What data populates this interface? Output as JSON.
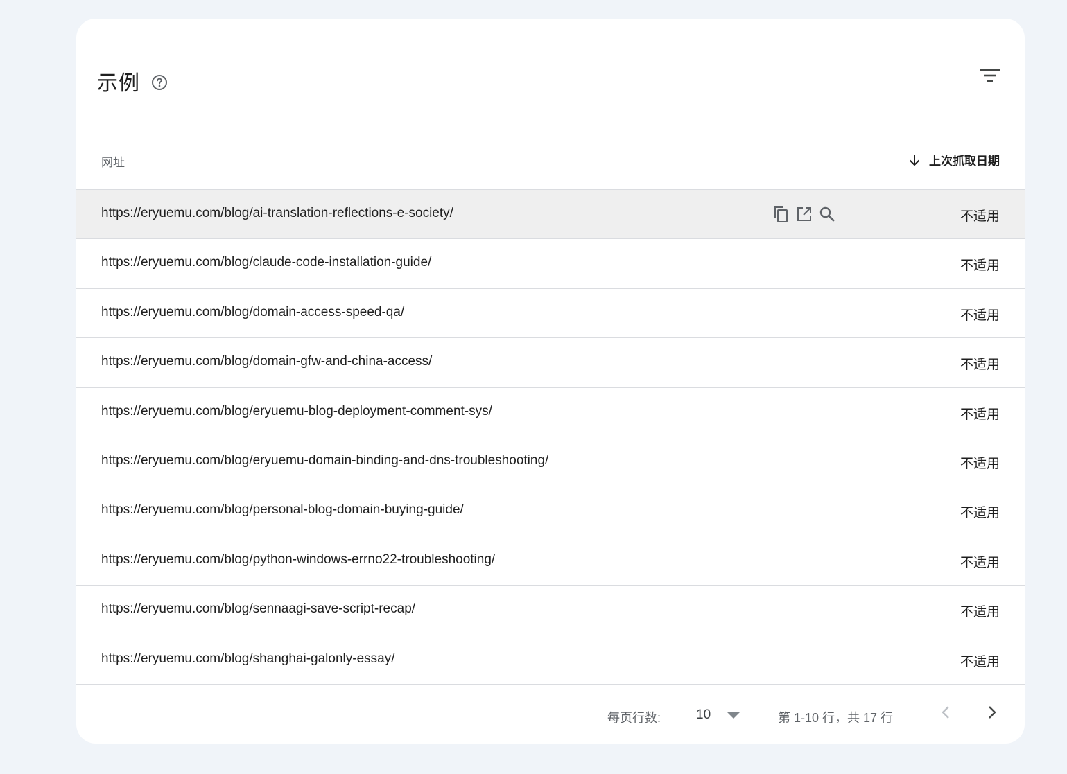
{
  "card": {
    "title": "示例"
  },
  "table": {
    "col_url": "网址",
    "col_date": "上次抓取日期",
    "rows": [
      {
        "url": "https://eryuemu.com/blog/ai-translation-reflections-e-society/",
        "date": "不适用"
      },
      {
        "url": "https://eryuemu.com/blog/claude-code-installation-guide/",
        "date": "不适用"
      },
      {
        "url": "https://eryuemu.com/blog/domain-access-speed-qa/",
        "date": "不适用"
      },
      {
        "url": "https://eryuemu.com/blog/domain-gfw-and-china-access/",
        "date": "不适用"
      },
      {
        "url": "https://eryuemu.com/blog/eryuemu-blog-deployment-comment-sys/",
        "date": "不适用"
      },
      {
        "url": "https://eryuemu.com/blog/eryuemu-domain-binding-and-dns-troubleshooting/",
        "date": "不适用"
      },
      {
        "url": "https://eryuemu.com/blog/personal-blog-domain-buying-guide/",
        "date": "不适用"
      },
      {
        "url": "https://eryuemu.com/blog/python-windows-errno22-troubleshooting/",
        "date": "不适用"
      },
      {
        "url": "https://eryuemu.com/blog/sennaagi-save-script-recap/",
        "date": "不适用"
      },
      {
        "url": "https://eryuemu.com/blog/shanghai-galonly-essay/",
        "date": "不适用"
      }
    ]
  },
  "footer": {
    "rows_per_page_label": "每页行数:",
    "rows_per_page_value": "10",
    "range_text": "第 1-10 行，共 17 行"
  },
  "icons": {
    "help": "help-circle-icon",
    "filter": "filter-icon",
    "sort": "arrow-down-icon",
    "copy": "copy-icon",
    "open": "open-in-new-icon",
    "inspect": "search-icon",
    "prev": "chevron-left-icon",
    "next": "chevron-right-icon"
  }
}
